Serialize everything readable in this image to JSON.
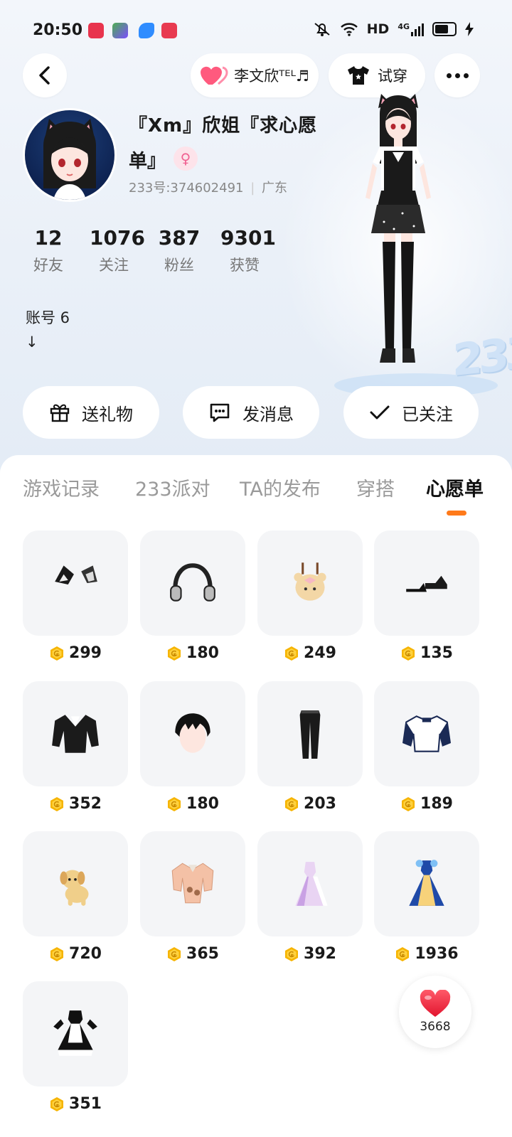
{
  "status_bar": {
    "time": "20:50",
    "network": "HD",
    "signal_label": "4G"
  },
  "header": {
    "song_label": "李文欣ᵀᴱᴸ♬",
    "try_on_label": "试穿"
  },
  "profile": {
    "name_line1": "『Xm』欣姐『求心愿",
    "name_line2": "单』",
    "uid": "233号:374602491",
    "region": "广东",
    "bio_line1": "账号 6",
    "bio_line2": "↓"
  },
  "stats": [
    {
      "num": "12",
      "label": "好友"
    },
    {
      "num": "1076",
      "label": "关注"
    },
    {
      "num": "387",
      "label": "粉丝"
    },
    {
      "num": "9301",
      "label": "获赞"
    }
  ],
  "actions": {
    "gift": "送礼物",
    "message": "发消息",
    "followed": "已关注"
  },
  "tabs": [
    {
      "label": "游戏记录",
      "active": false
    },
    {
      "label": "233派对",
      "active": false
    },
    {
      "label": "TA的发布",
      "active": false
    },
    {
      "label": "穿搭",
      "active": false
    },
    {
      "label": "心愿单",
      "active": true
    }
  ],
  "wishlist": [
    {
      "item": "cat-ears-icon",
      "price": "299"
    },
    {
      "item": "headphones-icon",
      "price": "180"
    },
    {
      "item": "bear-backpack-icon",
      "price": "249"
    },
    {
      "item": "shoes-icon",
      "price": "135"
    },
    {
      "item": "tuxedo-jacket-icon",
      "price": "352"
    },
    {
      "item": "black-hair-icon",
      "price": "180"
    },
    {
      "item": "black-pants-icon",
      "price": "203"
    },
    {
      "item": "jacket-icon",
      "price": "189"
    },
    {
      "item": "puppy-pet-icon",
      "price": "720"
    },
    {
      "item": "bear-hoodie-icon",
      "price": "365"
    },
    {
      "item": "lilac-dress-icon",
      "price": "392"
    },
    {
      "item": "blue-gown-icon",
      "price": "1936"
    },
    {
      "item": "maid-dress-icon",
      "price": "351"
    }
  ],
  "like": {
    "count": "3668"
  },
  "colors": {
    "accent": "#ff7a1a",
    "coin": "#f6b400",
    "heart": "#f03a4a"
  }
}
